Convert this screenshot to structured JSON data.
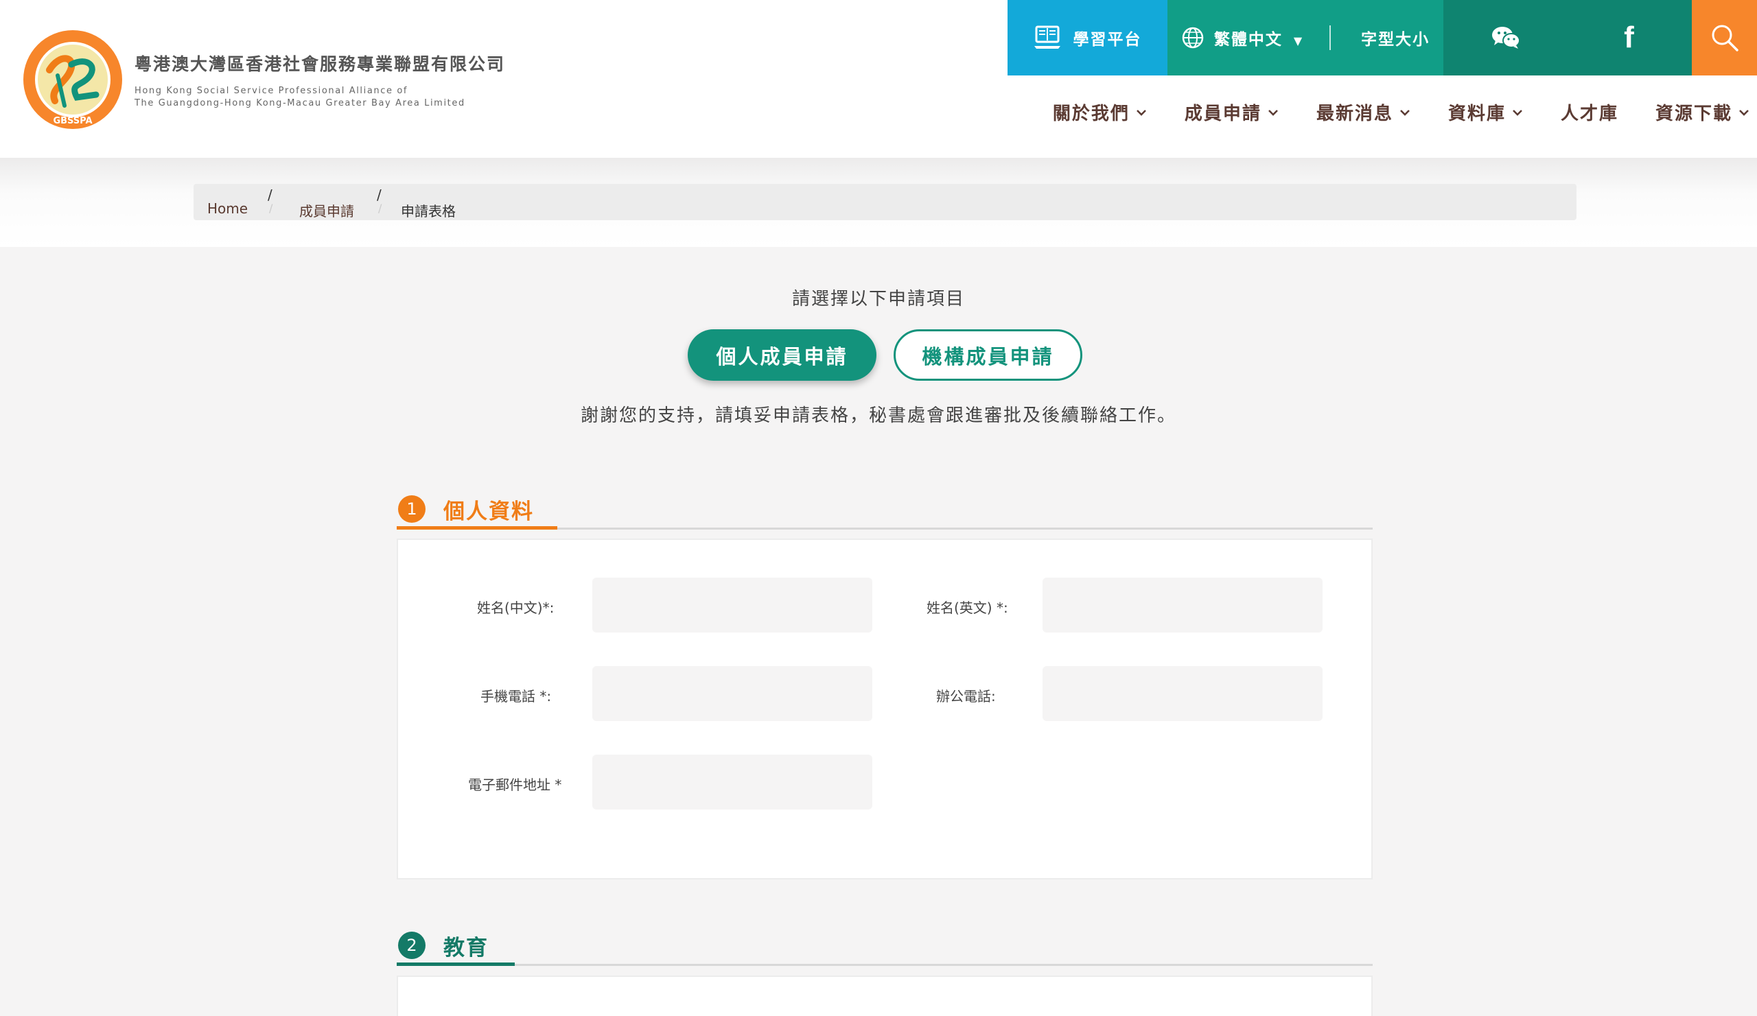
{
  "brand": {
    "name_zh": "粵港澳大灣區香港社會服務專業聯盟有限公司",
    "name_en_line1": "Hong Kong Social Service Professional Alliance of",
    "name_en_line2": "The Guangdong-Hong Kong-Macau Greater Bay Area Limited",
    "logo_text": "GBSSPA"
  },
  "topbar": {
    "learning_label": "學習平台",
    "language_label": "繁體中文",
    "language_caret": "▼",
    "font_size_label": "字型大小",
    "facebook_glyph": "f"
  },
  "nav": {
    "items": [
      {
        "label": "關於我們"
      },
      {
        "label": "成員申請"
      },
      {
        "label": "最新消息"
      },
      {
        "label": "資料庫"
      },
      {
        "label": "人才庫"
      },
      {
        "label": "資源下載"
      }
    ]
  },
  "breadcrumb": {
    "home": "Home",
    "level1": "成員申請",
    "current": "申請表格",
    "separator": "/"
  },
  "main": {
    "prompt": "請選擇以下申請項目",
    "btn_personal": "個人成員申請",
    "btn_org": "機構成員申請",
    "thanks": "謝謝您的支持，請填妥申請表格，秘書處會跟進審批及後續聯絡工作。"
  },
  "section1": {
    "number": "1",
    "title": "個人資料",
    "fields": {
      "name_zh_label": "姓名(中文)*:",
      "name_en_label": "姓名(英文) *:",
      "mobile_label": "手機電話 *:",
      "office_label": "辦公電話:",
      "email_label": "電子郵件地址 *",
      "name_zh_value": "",
      "name_en_value": "",
      "mobile_value": "",
      "office_value": "",
      "email_value": ""
    }
  },
  "section2": {
    "number": "2",
    "title": "教育"
  },
  "colors": {
    "blue": "#13a9d9",
    "green": "#119e87",
    "dark_green": "#0f8470",
    "orange": "#f7862b",
    "section_orange": "#f07d17",
    "brown": "#5b3b33"
  }
}
